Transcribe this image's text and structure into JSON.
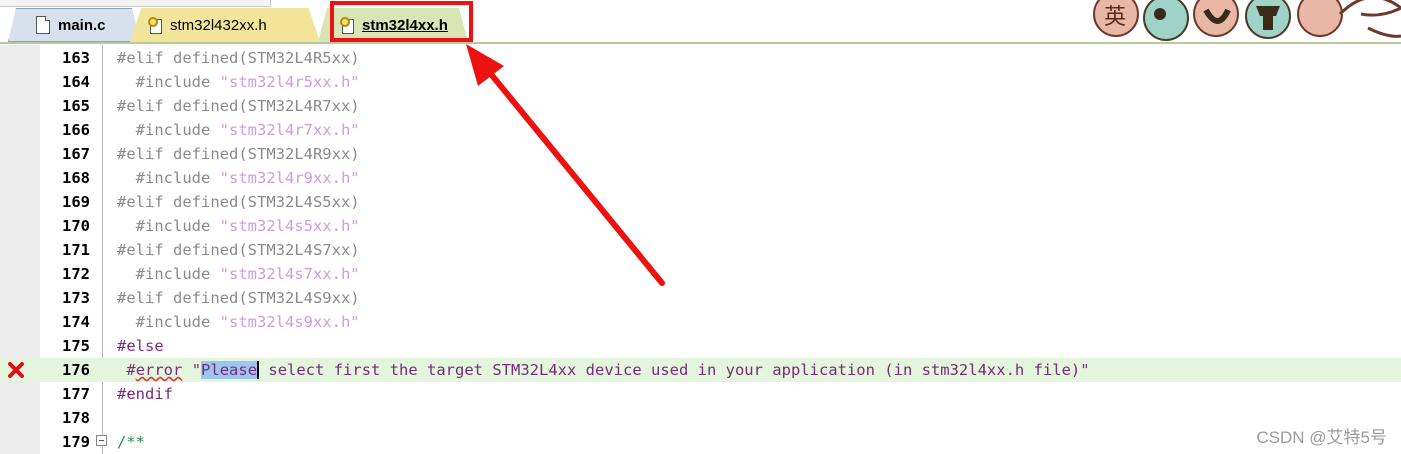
{
  "tabs": [
    {
      "label": "main.c",
      "icon": "file-icon"
    },
    {
      "label": "stm32l432xx.h",
      "icon": "key-file-icon"
    },
    {
      "label": "stm32l4xx.h",
      "icon": "key-file-icon",
      "active": true
    }
  ],
  "editor": {
    "lines": [
      {
        "num": "163",
        "directive": "#elif",
        "rest": " defined(STM32L4R5xx)",
        "inactive": true
      },
      {
        "num": "164",
        "directive": "  #include",
        "rest": " \"stm32l4r5xx.h\"",
        "inactive": true,
        "string": true
      },
      {
        "num": "165",
        "directive": "#elif",
        "rest": " defined(STM32L4R7xx)",
        "inactive": true
      },
      {
        "num": "166",
        "directive": "  #include",
        "rest": " \"stm32l4r7xx.h\"",
        "inactive": true,
        "string": true
      },
      {
        "num": "167",
        "directive": "#elif",
        "rest": " defined(STM32L4R9xx)",
        "inactive": true
      },
      {
        "num": "168",
        "directive": "  #include",
        "rest": " \"stm32l4r9xx.h\"",
        "inactive": true,
        "string": true
      },
      {
        "num": "169",
        "directive": "#elif",
        "rest": " defined(STM32L4S5xx)",
        "inactive": true
      },
      {
        "num": "170",
        "directive": "  #include",
        "rest": " \"stm32l4s5xx.h\"",
        "inactive": true,
        "string": true
      },
      {
        "num": "171",
        "directive": "#elif",
        "rest": " defined(STM32L4S7xx)",
        "inactive": true
      },
      {
        "num": "172",
        "directive": "  #include",
        "rest": " \"stm32l4s7xx.h\"",
        "inactive": true,
        "string": true
      },
      {
        "num": "173",
        "directive": "#elif",
        "rest": " defined(STM32L4S9xx)",
        "inactive": true
      },
      {
        "num": "174",
        "directive": "  #include",
        "rest": " \"stm32l4s9xx.h\"",
        "inactive": true,
        "string": true
      },
      {
        "num": "175",
        "directive": "#else",
        "rest": ""
      },
      {
        "num": "176",
        "error_line": true
      },
      {
        "num": "177",
        "directive": "#endif",
        "rest": ""
      },
      {
        "num": "178",
        "directive": "",
        "rest": ""
      },
      {
        "num": "179",
        "comment": "/**"
      }
    ],
    "error_line": {
      "indent": " ",
      "hash": "#",
      "keyword": "error",
      "space": " ",
      "quote_open": "\"",
      "selected_word": "Please",
      "message_rest": " select first the target STM32L4xx device used in your application (in stm32l4xx.h file)\""
    }
  },
  "watermark": "CSDN @艾特5号",
  "colors": {
    "error_marker": "#e01010",
    "highlight_box": "#ee1111",
    "arrow": "#ee1111"
  }
}
